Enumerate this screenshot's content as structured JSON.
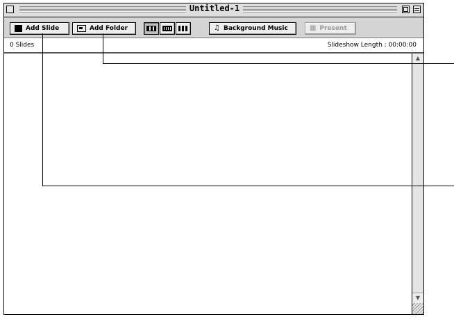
{
  "window": {
    "title": "Untitled-1"
  },
  "toolbar": {
    "add_slide": "Add Slide",
    "add_folder": "Add Folder",
    "background_music": "Background Music",
    "present": "Present",
    "view_modes": [
      "film-strip-view",
      "strip-view",
      "column-view"
    ],
    "active_view": "film-strip-view"
  },
  "status": {
    "slide_count": "0 Slides",
    "show_length": "Slideshow Length : 00:00:00"
  },
  "icons": {
    "close": "close-box",
    "zoom": "zoom-box",
    "collapse": "collapse-box",
    "slide": "slide-icon",
    "folder": "folder-icon",
    "music": "music-icon",
    "present": "present-icon"
  },
  "colors": {
    "chrome": "#dcdcdc",
    "content": "#ffffff",
    "border": "#000000",
    "disabled": "#9a9a9a"
  }
}
